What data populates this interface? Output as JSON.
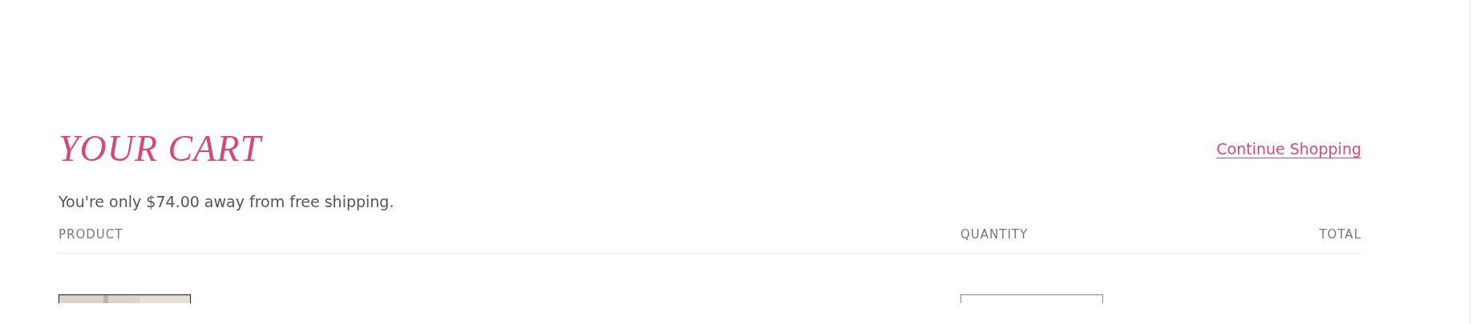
{
  "cart": {
    "title": "YOUR CART",
    "continue_link": "Continue Shopping",
    "shipping_notice": "You're only $74.00 away from free shipping.",
    "columns": [
      "PRODUCT",
      "QUANTITY",
      "TOTAL"
    ]
  }
}
